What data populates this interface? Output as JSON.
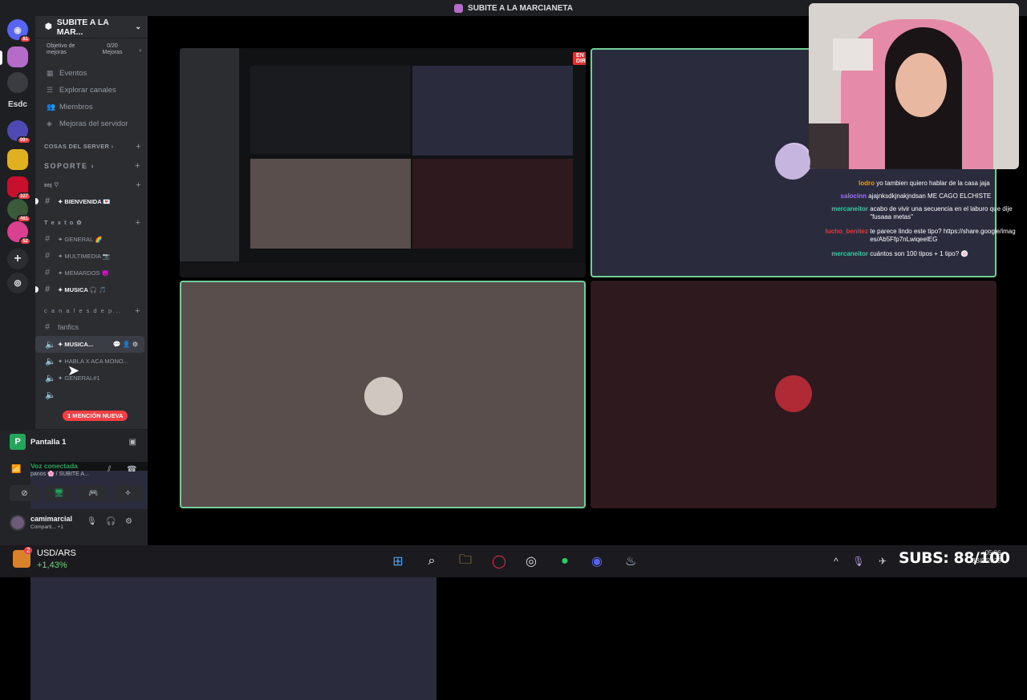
{
  "window": {
    "title": "SUBITE A LA MARCIANETA"
  },
  "rail": {
    "text_item": "Esdc",
    "badges": [
      "81",
      "99+",
      "327",
      "461",
      "52"
    ]
  },
  "server": {
    "name": "SUBITE A LA MAR...",
    "goal_label": "Objetivo de mejoras",
    "goal_value": "0/20 Mejoras"
  },
  "nav": [
    {
      "label": "Eventos"
    },
    {
      "label": "Explorar canales"
    },
    {
      "label": "Miembros"
    },
    {
      "label": "Mejoras del servidor"
    }
  ],
  "categories": {
    "cosas": "COSAS DEL SERVER",
    "soporte": "SOPORTE",
    "voz": "𝔳𝔬𝔷 ♡",
    "texto": "T e x t o ✿",
    "canales": "c a n a l e s  d e  p..."
  },
  "channels": {
    "bienvenida": "✦ BIENVENIDA 💌",
    "general": "✦ GENERAL 🌈",
    "multimedia": "✦ MULTIMEDIA 📷",
    "memardos": "✦ MEMARDOS 😈",
    "musica_text": "✦ MUSICA 🎧 🎵",
    "fanfics": "fanfics",
    "musica_voice": "✦ MUSICA...",
    "habla": "✦ HABLA X ACA MONO...",
    "general1": "✦ GENERAL#1"
  },
  "mention_badge": "1 MENCIÓN NUEVA",
  "voice_panel": {
    "screen_label": "Pantalla 1",
    "status": "Voz conectada",
    "location": "panos 🌸 / SUBITE A..."
  },
  "user": {
    "name": "camimarcial",
    "status": "Comparti... +1"
  },
  "stream": {
    "live_badge": "EN DIRECTO"
  },
  "chat": [
    {
      "user": "lodro",
      "text": "yo tambien quiero hablar de la casa jaja",
      "color": "#e0a030"
    },
    {
      "user": "salocinn",
      "text": "ajajnksdkjnakjndsan ME CAGO ELCHISTE",
      "color": "#a070ff"
    },
    {
      "user": "mercaneitor",
      "text": "acabo de vivir una secuencia en el laburo que dije \"fusaaa metas\"",
      "color": "#3ac9a0"
    },
    {
      "user": "lucho_benitez",
      "text": "te parece lindo este tipo? https://share.google/images/Ab5Ffp7nLwiqeelEG",
      "color": "#e03a3a"
    },
    {
      "user": "mercaneitor",
      "text": "cuántos son 100 tipos + 1 tipo? 🍥",
      "color": "#3ac9a0"
    }
  ],
  "taskbar": {
    "ticker_name": "USD/ARS",
    "ticker_change": "+1,43%",
    "ticker_badge": "2",
    "subs": "SUBS: 88/100",
    "time": "05:06",
    "date": "13/9/2025"
  }
}
